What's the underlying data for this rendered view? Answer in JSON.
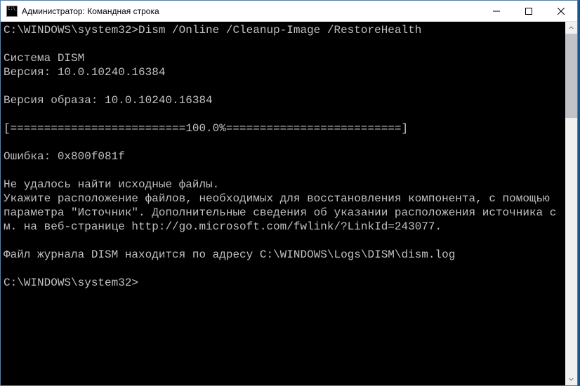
{
  "titlebar": {
    "title": "Администратор: Командная строка"
  },
  "terminal": {
    "line1": "C:\\WINDOWS\\system32>Dism /Online /Cleanup-Image /RestoreHealth",
    "blank1": "",
    "line2": "Cистема DISM",
    "line3": "Версия: 10.0.10240.16384",
    "blank2": "",
    "line4": "Версия образа: 10.0.10240.16384",
    "blank3": "",
    "line5": "[==========================100.0%==========================]",
    "blank4": "",
    "line6": "Ошибка: 0x800f081f",
    "blank5": "",
    "line7": "Не удалось найти исходные файлы.",
    "line8": "Укажите расположение файлов, необходимых для восстановления компонента, с помощью параметра \"Источник\". Дополнительные сведения об указании расположения источника см. на веб-странице http://go.microsoft.com/fwlink/?LinkId=243077.",
    "blank6": "",
    "line9": "Файл журнала DISM находится по адресу C:\\WINDOWS\\Logs\\DISM\\dism.log",
    "blank7": "",
    "line10": "C:\\WINDOWS\\system32>"
  }
}
